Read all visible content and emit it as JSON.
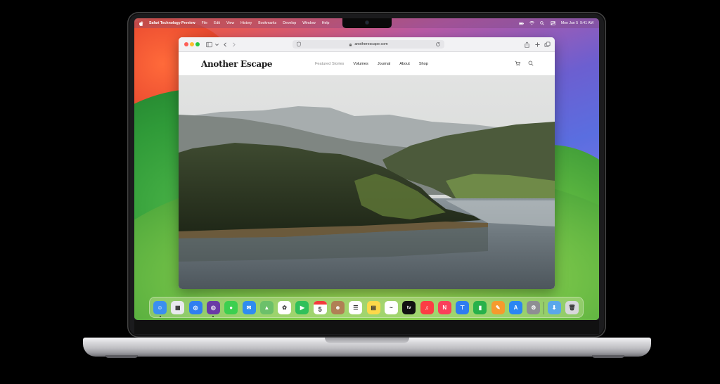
{
  "menubar": {
    "app_name": "Safari Technology Preview",
    "items": [
      "File",
      "Edit",
      "View",
      "History",
      "Bookmarks",
      "Develop",
      "Window",
      "Help"
    ],
    "datetime": "Mon Jun 5  9:41 AM"
  },
  "safari": {
    "url": "anotherescape.com"
  },
  "site": {
    "logo": "Another Escape",
    "nav": [
      "Featured Stories",
      "Volumes",
      "Journal",
      "About",
      "Shop"
    ]
  },
  "dock": {
    "apps": [
      {
        "name": "Finder",
        "color": "#3a8ff0",
        "glyph": "☺"
      },
      {
        "name": "Launchpad",
        "color": "#e9e9ee",
        "glyph": "▦"
      },
      {
        "name": "Safari",
        "color": "#2f7ff0",
        "glyph": "◎"
      },
      {
        "name": "Safari Technology Preview",
        "color": "#6a3aa6",
        "glyph": "◎"
      },
      {
        "name": "Messages",
        "color": "#3ccf4f",
        "glyph": "●"
      },
      {
        "name": "Mail",
        "color": "#2f8cf0",
        "glyph": "✉"
      },
      {
        "name": "Maps",
        "color": "#6cc06a",
        "glyph": "▲"
      },
      {
        "name": "Photos",
        "color": "#ffffff",
        "glyph": "✿"
      },
      {
        "name": "FaceTime",
        "color": "#30c05a",
        "glyph": "▶"
      },
      {
        "name": "Calendar",
        "color": "#ffffff",
        "glyph": "5"
      },
      {
        "name": "Contacts",
        "color": "#b08055",
        "glyph": "☻"
      },
      {
        "name": "Reminders",
        "color": "#ffffff",
        "glyph": "☰"
      },
      {
        "name": "Notes",
        "color": "#fcd94a",
        "glyph": "▤"
      },
      {
        "name": "Freeform",
        "color": "#ffffff",
        "glyph": "~"
      },
      {
        "name": "TV",
        "color": "#111111",
        "glyph": "tv"
      },
      {
        "name": "Music",
        "color": "#fc3c44",
        "glyph": "♫"
      },
      {
        "name": "News",
        "color": "#fa3f5a",
        "glyph": "N"
      },
      {
        "name": "Keynote",
        "color": "#2e7cf0",
        "glyph": "⊤"
      },
      {
        "name": "Numbers",
        "color": "#28b14a",
        "glyph": "▮"
      },
      {
        "name": "Pages",
        "color": "#f59a2d",
        "glyph": "✎"
      },
      {
        "name": "App Store",
        "color": "#2a86f3",
        "glyph": "A"
      },
      {
        "name": "System Settings",
        "color": "#8e8e93",
        "glyph": "⚙"
      },
      {
        "name": "Downloads",
        "color": "#5aa7ea",
        "glyph": "⬇"
      },
      {
        "name": "Trash",
        "color": "#d8d8dc",
        "glyph": "🗑"
      }
    ],
    "calendar_day": "5",
    "tv_label": "tv"
  }
}
